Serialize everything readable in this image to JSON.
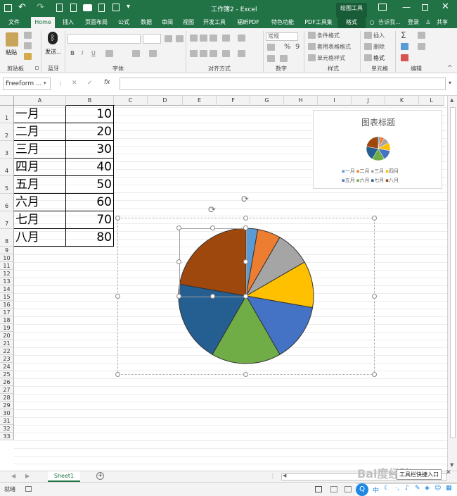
{
  "titlebar": {
    "doc_title": "工作簿2 - Excel",
    "context_tab": "绘图工具",
    "user": "登录",
    "share": "共享"
  },
  "tabs": [
    "文件",
    "Home",
    "插入",
    "页面布局",
    "公式",
    "数据",
    "审阅",
    "视图",
    "开发工具",
    "福昕PDF",
    "特色功能",
    "PDF工具集",
    "格式"
  ],
  "tell_me": "告诉我...",
  "ribbon": {
    "clipboard": {
      "paste": "粘贴",
      "label": "剪贴板"
    },
    "bluetooth": {
      "send": "发送...",
      "label": "蓝牙"
    },
    "font": {
      "label": "字体",
      "bold": "B",
      "italic": "I",
      "underline": "U"
    },
    "alignment": {
      "label": "对齐方式"
    },
    "number": {
      "format": "常规",
      "percent": "%",
      "comma": "9",
      "label": "数字"
    },
    "styles": {
      "cond": "条件格式",
      "table": "套用表格格式",
      "cell": "单元格样式",
      "label": "样式"
    },
    "cells": {
      "insert": "插入",
      "delete": "删除",
      "format": "格式",
      "label": "单元格"
    },
    "editing": {
      "label": "编辑"
    }
  },
  "formula": {
    "namebox": "Freeform ...",
    "fx": "fx",
    "cancel": "✕",
    "confirm": "✓"
  },
  "columns": [
    "A",
    "B",
    "C",
    "D",
    "E",
    "F",
    "G",
    "H",
    "I",
    "J",
    "K",
    "L"
  ],
  "rows": [
    "1",
    "2",
    "3",
    "4",
    "5",
    "6",
    "7",
    "8",
    "9",
    "10",
    "11",
    "12",
    "13",
    "14",
    "15",
    "16",
    "17",
    "18",
    "19",
    "20",
    "21",
    "22",
    "23",
    "24",
    "25",
    "26",
    "27",
    "28",
    "29",
    "30",
    "31",
    "32",
    "33"
  ],
  "cells": [
    {
      "a": "一月",
      "b": "10"
    },
    {
      "a": "二月",
      "b": "20"
    },
    {
      "a": "三月",
      "b": "30"
    },
    {
      "a": "四月",
      "b": "40"
    },
    {
      "a": "五月",
      "b": "50"
    },
    {
      "a": "六月",
      "b": "60"
    },
    {
      "a": "七月",
      "b": "70"
    },
    {
      "a": "八月",
      "b": "80"
    }
  ],
  "mini_chart": {
    "title": "图表标题",
    "legend": [
      "一月",
      "二月",
      "三月",
      "四月",
      "五月",
      "六月",
      "七月",
      "八月"
    ]
  },
  "chart_data": {
    "type": "pie",
    "categories": [
      "一月",
      "二月",
      "三月",
      "四月",
      "五月",
      "六月",
      "七月",
      "八月"
    ],
    "values": [
      10,
      20,
      30,
      40,
      50,
      60,
      70,
      80
    ],
    "colors": [
      "#5b9bd5",
      "#ed7d31",
      "#a5a5a5",
      "#ffc000",
      "#4472c4",
      "#70ad47",
      "#255e91",
      "#9e480e"
    ]
  },
  "sheet": {
    "tab": "Sheet1",
    "add": "+"
  },
  "status": {
    "ready": "就绪",
    "watermark": "Bai度经验",
    "ime": "工具栏快捷入口",
    "ime_lang": "中"
  }
}
